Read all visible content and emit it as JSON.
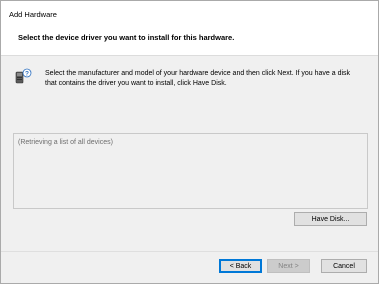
{
  "window": {
    "title": "Add Hardware"
  },
  "header": {
    "text": "Select the device driver you want to install for this hardware."
  },
  "instructions": "Select the manufacturer and model of your hardware device and then click Next. If you have a disk that contains the driver you want to install, click Have Disk.",
  "device_list": {
    "status_text": "(Retrieving a list of all devices)"
  },
  "buttons": {
    "have_disk": "Have Disk...",
    "back": "< Back",
    "next": "Next >",
    "cancel": "Cancel"
  },
  "icons": {
    "device": "device-question-icon"
  },
  "colors": {
    "accent": "#0078d7",
    "background": "#f0f0f0"
  }
}
